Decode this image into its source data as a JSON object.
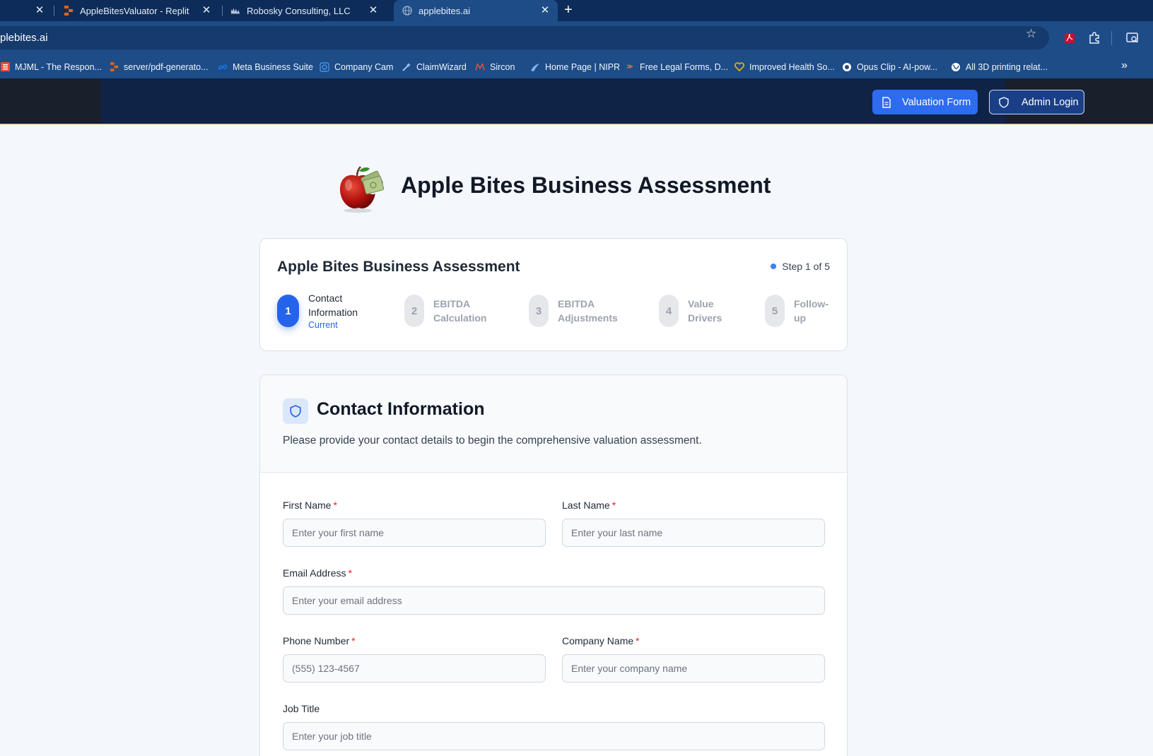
{
  "browser": {
    "tabs": [
      {
        "title": "",
        "active": false
      },
      {
        "title": "AppleBitesValuator - Replit",
        "active": false
      },
      {
        "title": "Robosky Consulting, LLC",
        "active": false
      },
      {
        "title": "applebites.ai",
        "active": true
      }
    ],
    "url": "plebites.ai",
    "bookmarks": [
      "MJML - The Respon...",
      "server/pdf-generato...",
      "Meta Business Suite",
      "Company Cam",
      "ClaimWizard",
      "Sircon",
      "Home Page | NIPR",
      "Free Legal Forms, D...",
      "Improved Health So...",
      "Opus Clip - AI-pow...",
      "All 3D printing relat..."
    ]
  },
  "header": {
    "valuation_form": "Valuation Form",
    "admin_login": "Admin Login"
  },
  "brand": {
    "title": "Apple Bites Business Assessment"
  },
  "progress": {
    "title": "Apple Bites Business Assessment",
    "step_indicator": "Step 1 of 5",
    "current_step": 1,
    "total_steps": 5,
    "steps": [
      {
        "number": "1",
        "label": "Contact Information",
        "status": "Current"
      },
      {
        "number": "2",
        "label": "EBITDA Calculation"
      },
      {
        "number": "3",
        "label": "EBITDA Adjustments"
      },
      {
        "number": "4",
        "label": "Value Drivers"
      },
      {
        "number": "5",
        "label": "Follow-up"
      }
    ]
  },
  "form": {
    "title": "Contact Information",
    "description": "Please provide your contact details to begin the comprehensive valuation assessment.",
    "required_marker": "*",
    "fields": {
      "first_name": {
        "label": "First Name",
        "placeholder": "Enter your first name",
        "value": ""
      },
      "last_name": {
        "label": "Last Name",
        "placeholder": "Enter your last name",
        "value": ""
      },
      "email": {
        "label": "Email Address",
        "placeholder": "Enter your email address",
        "value": ""
      },
      "phone": {
        "label": "Phone Number",
        "placeholder": "(555) 123-4567",
        "value": ""
      },
      "company": {
        "label": "Company Name",
        "placeholder": "Enter your company name",
        "value": ""
      },
      "job_title": {
        "label": "Job Title",
        "placeholder": "Enter your job title",
        "value": ""
      }
    }
  },
  "colors": {
    "primary": "#2563eb",
    "header_bg": "#0f2347",
    "required": "#dc2626"
  }
}
